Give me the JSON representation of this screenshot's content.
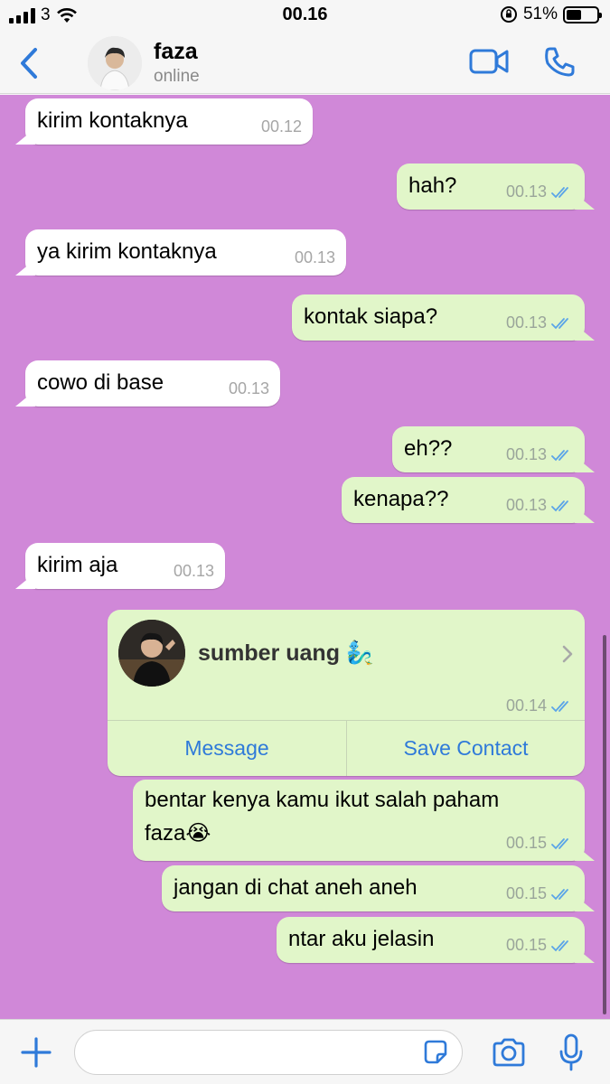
{
  "status_bar": {
    "carrier": "3",
    "time": "00.16",
    "battery": "51%",
    "battery_level": 0.51
  },
  "header": {
    "contact_name": "faza",
    "contact_status": "online"
  },
  "messages": [
    {
      "direction": "in",
      "text": "kirim kontaknya",
      "time": "00.12"
    },
    {
      "direction": "out",
      "text": "hah?",
      "time": "00.13"
    },
    {
      "direction": "in",
      "text": "ya kirim kontaknya",
      "time": "00.13"
    },
    {
      "direction": "out",
      "text": "kontak siapa?",
      "time": "00.13"
    },
    {
      "direction": "in",
      "text": "cowo di base",
      "time": "00.13"
    },
    {
      "direction": "out",
      "text": "eh??",
      "time": "00.13"
    },
    {
      "direction": "out",
      "text": "kenapa??",
      "time": "00.13"
    },
    {
      "direction": "in",
      "text": "kirim aja",
      "time": "00.13"
    },
    {
      "direction": "out",
      "text_line1": "bentar kenya kamu ikut salah paham",
      "text_line2": "faza😭",
      "time": "00.15"
    },
    {
      "direction": "out",
      "text": "jangan di chat aneh aneh",
      "time": "00.15"
    },
    {
      "direction": "out",
      "text": "ntar aku jelasin",
      "time": "00.15"
    }
  ],
  "contact_card": {
    "name": "sumber uang 🧞‍♂️",
    "time": "00.14",
    "action_message": "Message",
    "action_save": "Save Contact"
  },
  "input_bar": {
    "placeholder": ""
  },
  "icons": {
    "back": "chevron-left-icon",
    "video": "video-camera-icon",
    "call": "phone-icon",
    "read_receipt": "double-check-icon",
    "plus": "plus-icon",
    "sticker": "sticker-icon",
    "camera": "camera-icon",
    "mic": "microphone-icon"
  },
  "colors": {
    "chat_background": "#d088d8",
    "incoming_bubble": "#ffffff",
    "outgoing_bubble": "#e1f6c9",
    "accent": "#2f7ad9",
    "read_ticks": "#5aa4e8"
  }
}
